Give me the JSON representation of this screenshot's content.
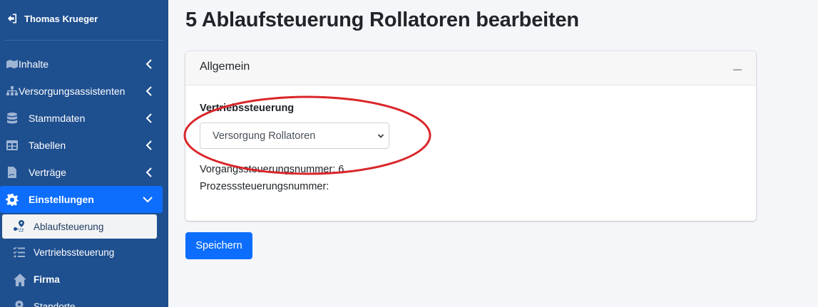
{
  "user": {
    "name": "Thomas Krueger"
  },
  "sidebar": {
    "items": [
      {
        "label": "Inhalte"
      },
      {
        "label": "Versorgungsassistenten"
      },
      {
        "label": "Stammdaten"
      },
      {
        "label": "Tabellen"
      },
      {
        "label": "Verträge"
      },
      {
        "label": "Einstellungen"
      }
    ],
    "subitems": [
      {
        "label": "Ablaufsteuerung"
      },
      {
        "label": "Vertriebssteuerung"
      },
      {
        "label": "Firma"
      },
      {
        "label": "Standorte"
      }
    ]
  },
  "page": {
    "title": "5 Ablaufsteuerung Rollatoren bearbeiten"
  },
  "card": {
    "title": "Allgemein",
    "field_label": "Vertriebssteuerung",
    "select_value": "Versorgung Rollatoren",
    "vorgang_line": "Vorgangssteuerungsnummer: 6",
    "prozess_line": "Prozesssteuerungsnummer:"
  },
  "actions": {
    "save_label": "Speichern"
  },
  "colors": {
    "sidebar_bg": "#1e4f8f",
    "accent": "#0d6efd",
    "annotation": "#d9262a"
  }
}
